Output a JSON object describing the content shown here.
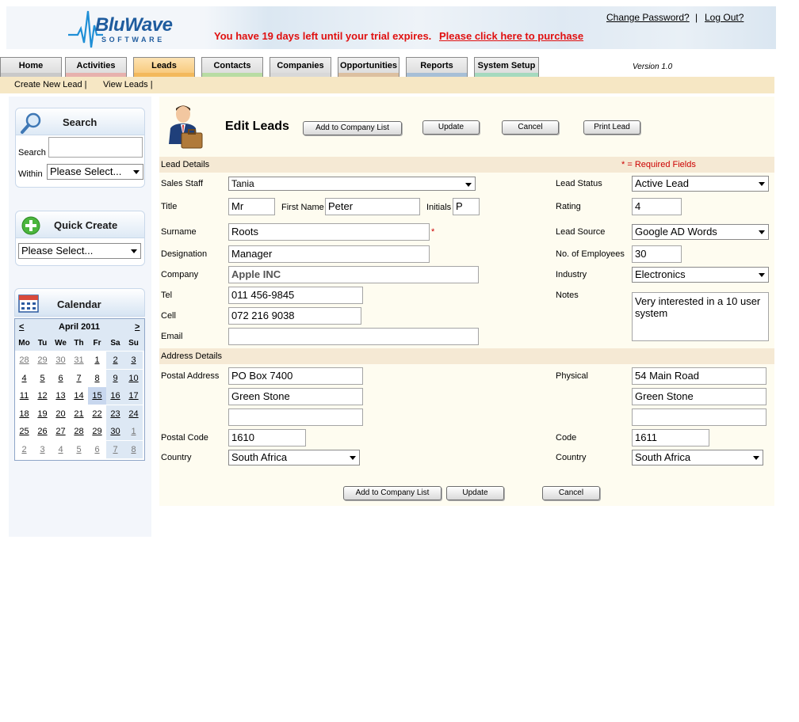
{
  "header": {
    "logo_text": "BluWave",
    "logo_sub": "SOFTWARE",
    "trial_message": "You have 19 days left until your trial expires.",
    "trial_link": "Please click here to purchase",
    "change_password": "Change Password?",
    "separator": "|",
    "logout": "Log Out?"
  },
  "tabs": [
    {
      "label": "Home",
      "strip": "#c9c9c9"
    },
    {
      "label": "Activities",
      "strip": "#e7b1ad"
    },
    {
      "label": "Leads",
      "strip": "#f3b95c"
    },
    {
      "label": "Contacts",
      "strip": "#b8dca3"
    },
    {
      "label": "Companies",
      "strip": "#d8d8d8"
    },
    {
      "label": "Opportunities",
      "strip": "#dcc0a0"
    },
    {
      "label": "Reports",
      "strip": "#a7bfd6"
    },
    {
      "label": "System Setup",
      "strip": "#a5d9be"
    }
  ],
  "version": "Version 1.0",
  "subnav": {
    "create": "Create New Lead |",
    "view": "View Leads |"
  },
  "sidebar": {
    "search": {
      "title": "Search",
      "search_label": "Search",
      "within_label": "Within",
      "within_value": "Please Select..."
    },
    "quick_create": {
      "title": "Quick Create",
      "value": "Please Select..."
    },
    "calendar": {
      "title": "Calendar",
      "prev": "<",
      "next": ">",
      "month": "April 2011",
      "dow": [
        "Mo",
        "Tu",
        "We",
        "Th",
        "Fr",
        "Sa",
        "Su"
      ],
      "weeks": [
        [
          "28",
          "29",
          "30",
          "31",
          "1",
          "2",
          "3"
        ],
        [
          "4",
          "5",
          "6",
          "7",
          "8",
          "9",
          "10"
        ],
        [
          "11",
          "12",
          "13",
          "14",
          "15",
          "16",
          "17"
        ],
        [
          "18",
          "19",
          "20",
          "21",
          "22",
          "23",
          "24"
        ],
        [
          "25",
          "26",
          "27",
          "28",
          "29",
          "30",
          "1"
        ],
        [
          "2",
          "3",
          "4",
          "5",
          "6",
          "7",
          "8"
        ]
      ],
      "today": "15"
    }
  },
  "main": {
    "title": "Edit Leads",
    "buttons": {
      "add_company": "Add to Company List",
      "update": "Update",
      "cancel": "Cancel",
      "print": "Print Lead"
    },
    "lead_details": "Lead Details",
    "required_note": "* = Required Fields",
    "required_star": "*",
    "labels": {
      "sales_staff": "Sales Staff",
      "title": "Title",
      "first_name": "First Name",
      "initials": "Initials",
      "surname": "Surname",
      "designation": "Designation",
      "company": "Company",
      "tel": "Tel",
      "cell": "Cell",
      "email": "Email",
      "lead_status": "Lead Status",
      "rating": "Rating",
      "lead_source": "Lead Source",
      "employees": "No. of Employees",
      "industry": "Industry",
      "notes": "Notes"
    },
    "values": {
      "sales_staff": "Tania",
      "title": "Mr",
      "first_name": "Peter",
      "initials": "P",
      "surname": "Roots",
      "designation": "Manager",
      "company": "Apple INC",
      "tel": "011 456-9845",
      "cell": "072 216 9038",
      "email": "",
      "lead_status": "Active Lead",
      "rating": "4",
      "lead_source": "Google AD Words",
      "employees": "30",
      "industry": "Electronics",
      "notes": "Very interested in a 10 user system"
    },
    "address_details": "Address Details",
    "address": {
      "postal_label": "Postal Address",
      "physical_label": "Physical",
      "postal_1": "PO Box 7400",
      "postal_2": "Green Stone",
      "postal_3": "",
      "physical_1": "54 Main Road",
      "physical_2": "Green Stone",
      "physical_3": "",
      "postal_code_label": "Postal Code",
      "postal_code": "1610",
      "code_label": "Code",
      "code": "1611",
      "country_label": "Country",
      "country": "South Africa",
      "country2_label": "Country",
      "country2": "South Africa"
    }
  }
}
